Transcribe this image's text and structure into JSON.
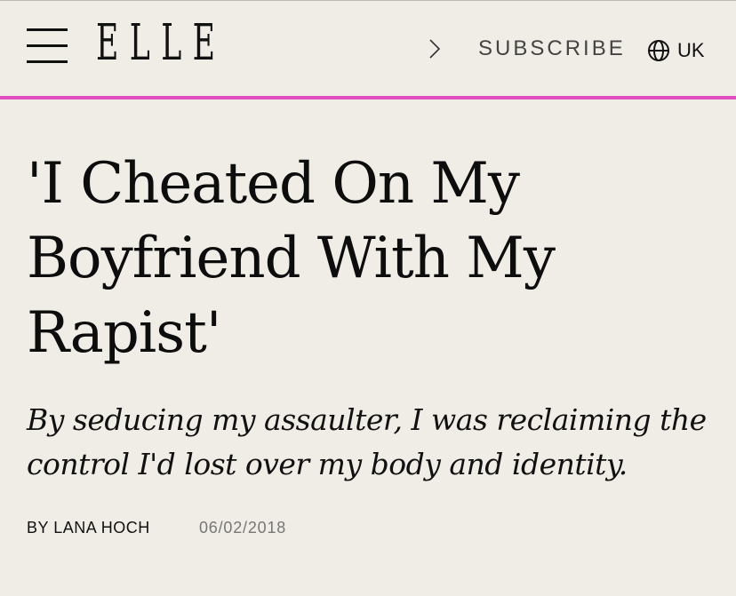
{
  "header": {
    "logo_text": "ELLE",
    "subscribe_label": "SUBSCRIBE",
    "edition_label": "UK",
    "icons": [
      "menu-icon",
      "chevron-right-icon",
      "globe-icon"
    ]
  },
  "colors": {
    "background": "#f0ece6",
    "accent": "#e04fc0",
    "text": "#111111",
    "muted": "#777777"
  },
  "article": {
    "headline": "'I Cheated On My Boyfriend With My Rapist'",
    "dek": "By seducing my assaulter, I was reclaiming the control I'd lost over my body and identity.",
    "byline": "BY LANA HOCH",
    "date": "06/02/2018"
  }
}
